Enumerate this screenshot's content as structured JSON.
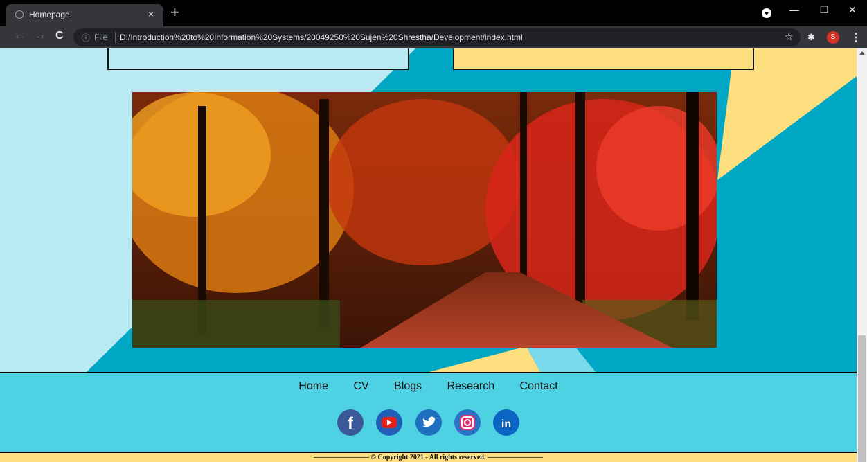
{
  "browser": {
    "tab_title": "Homepage",
    "tab_close": "×",
    "new_tab": "+",
    "file_label": "File",
    "url": "D:/Introduction%20to%20Information%20Systems/20049250%20Sujen%20Shrestha/Development/index.html",
    "avatar_initial": "S",
    "icons": [
      "globe-icon",
      "close-icon",
      "plus-icon",
      "back-icon",
      "forward-icon",
      "reload-icon",
      "info-icon",
      "star-icon",
      "puzzle-icon",
      "kebab-icon",
      "minimize-icon",
      "restore-icon",
      "close-window-icon"
    ]
  },
  "footer": {
    "nav": [
      "Home",
      "CV",
      "Blogs",
      "Research",
      "Contact"
    ],
    "social": [
      {
        "name": "facebook-icon",
        "glyph": "f",
        "color": "#3b5998"
      },
      {
        "name": "youtube-icon",
        "glyph": "▶",
        "color": "#e62117"
      },
      {
        "name": "twitter-icon",
        "glyph": "🐦",
        "color": "#1da1f2"
      },
      {
        "name": "instagram-icon",
        "glyph": "◎",
        "color": "#c13584"
      },
      {
        "name": "linkedin-icon",
        "glyph": "in",
        "color": "#0a66c2"
      }
    ],
    "copyright": "———————— © Copyright 2021 - All rights reserved. ————————"
  },
  "colors": {
    "light_blue": "#b9e9f3",
    "teal": "#00a7c4",
    "yellow": "#fddf80",
    "footer_bg": "#4fd1e4"
  }
}
